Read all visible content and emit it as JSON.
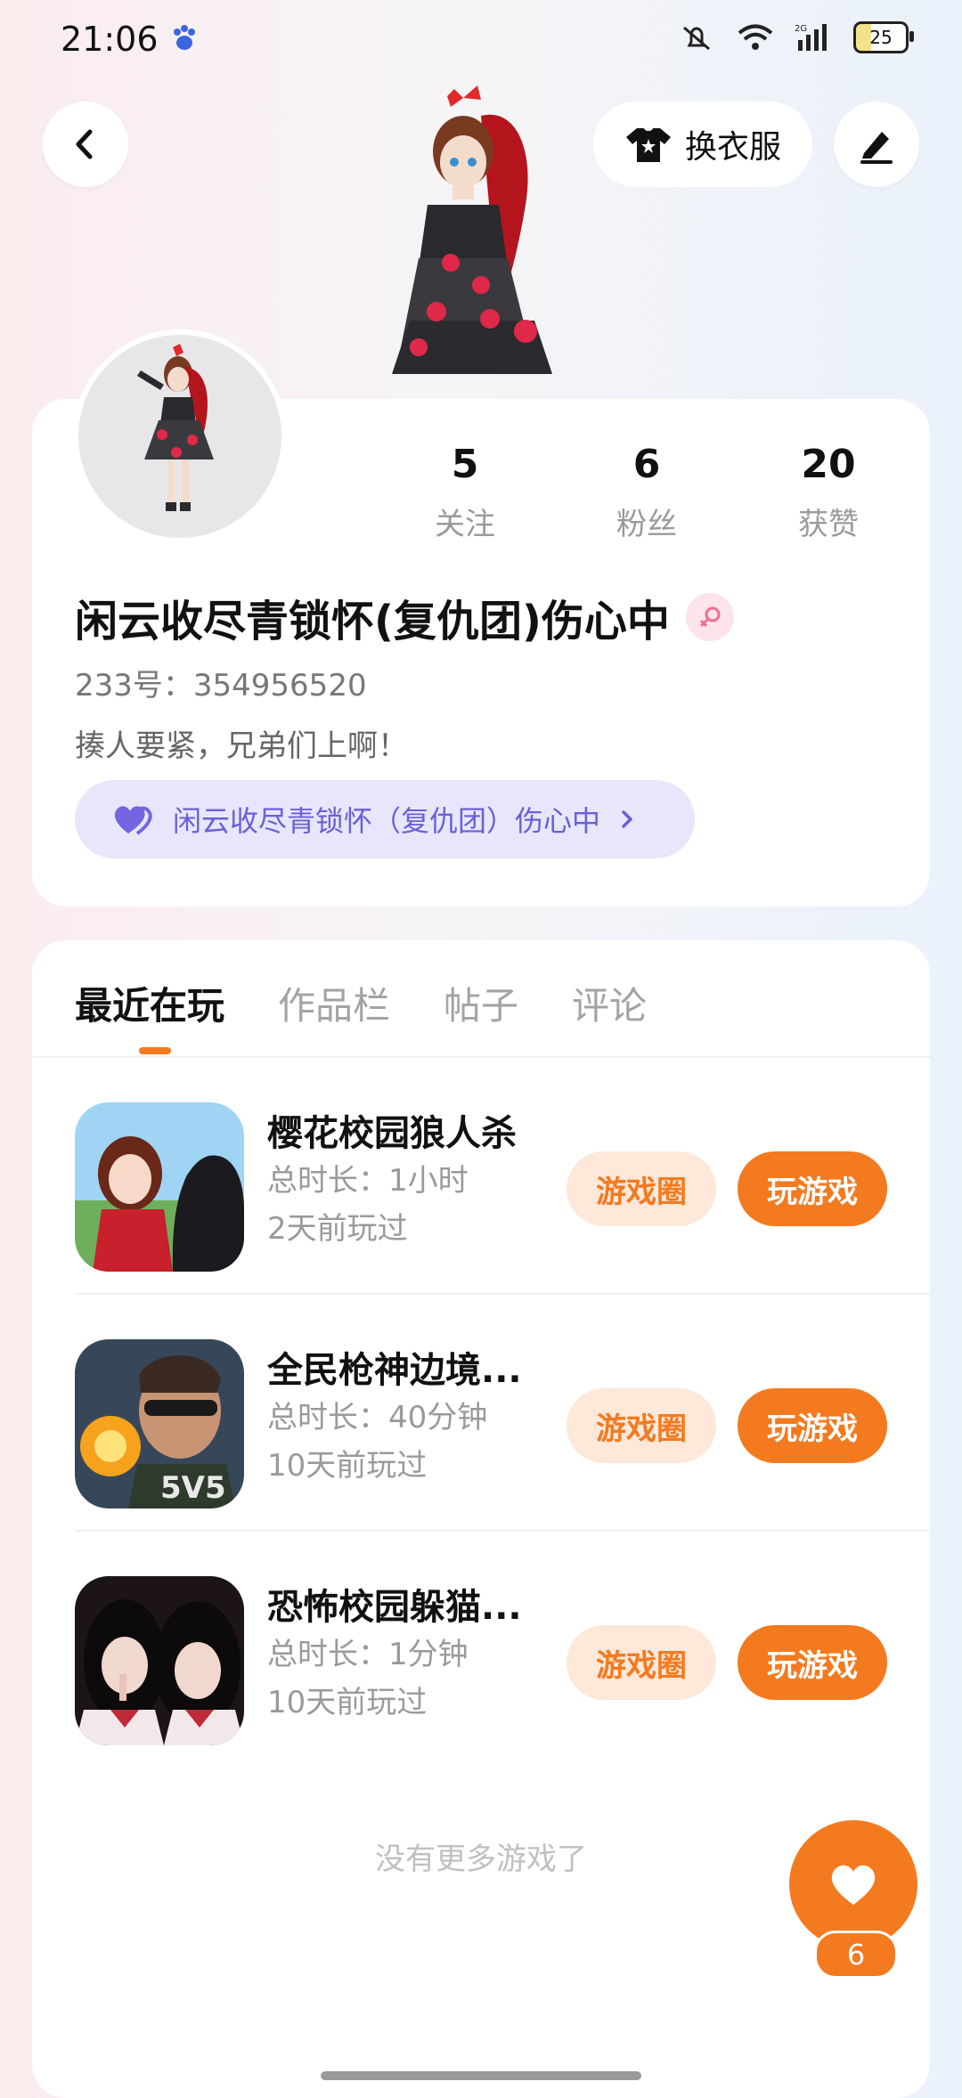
{
  "status_bar": {
    "time": "21:06",
    "battery": "25"
  },
  "header": {
    "outfit_label": "换衣服"
  },
  "profile": {
    "stats": [
      {
        "value": "5",
        "label": "关注"
      },
      {
        "value": "6",
        "label": "粉丝"
      },
      {
        "value": "20",
        "label": "获赞"
      }
    ],
    "name": "闲云收尽青锁怀(复仇团)伤心中",
    "id_line": "233号：354956520",
    "bio": "揍人要紧，兄弟们上啊！",
    "group_label": "闲云收尽青锁怀（复仇团）伤心中"
  },
  "tabs": [
    "最近在玩",
    "作品栏",
    "帖子",
    "评论"
  ],
  "games": [
    {
      "title": "樱花校园狼人杀",
      "duration": "总时长：1小时",
      "last_played": "2天前玩过",
      "circle_label": "游戏圈",
      "play_label": "玩游戏"
    },
    {
      "title": "全民枪神边境...",
      "duration": "总时长：40分钟",
      "last_played": "10天前玩过",
      "circle_label": "游戏圈",
      "play_label": "玩游戏"
    },
    {
      "title": "恐怖校园躲猫...",
      "duration": "总时长：1分钟",
      "last_played": "10天前玩过",
      "circle_label": "游戏圈",
      "play_label": "玩游戏"
    }
  ],
  "footer_text": "没有更多游戏了",
  "like_count": "6",
  "colors": {
    "accent": "#f47a1f",
    "accent_light": "#fde8d9",
    "group_bg": "#e8e6fb",
    "group_text": "#6b5fd6"
  }
}
